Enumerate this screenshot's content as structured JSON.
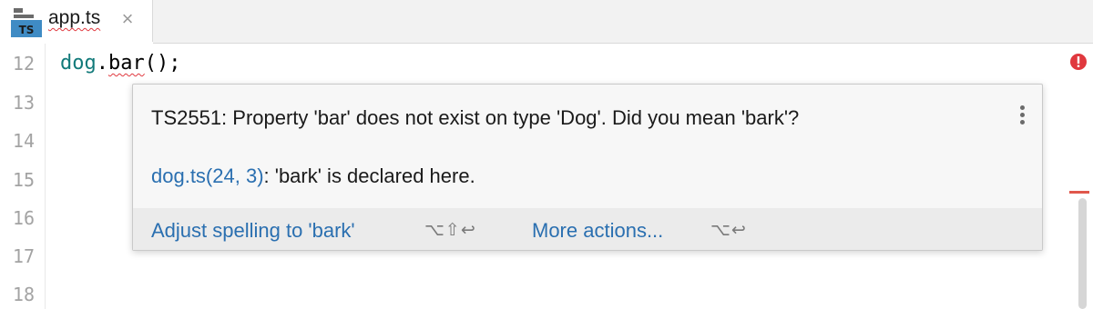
{
  "tab": {
    "icon_label": "TS",
    "file_name": "app.ts",
    "close_glyph": "×"
  },
  "editor": {
    "line_numbers": [
      "12",
      "13",
      "14",
      "15",
      "16",
      "17",
      "18"
    ],
    "code": {
      "ident": "dog",
      "dot": ".",
      "error_token": "bar",
      "rest": "();"
    }
  },
  "popup": {
    "message": "TS2551: Property 'bar' does not exist on type 'Dog'. Did you mean 'bark'?",
    "decl_link": "dog.ts(24, 3)",
    "decl_text": ": 'bark' is declared here.",
    "actions": [
      {
        "label": "Adjust spelling to 'bark'",
        "shortcut": "⌥⇧↩"
      },
      {
        "label": "More actions...",
        "shortcut": "⌥↩"
      }
    ]
  },
  "colors": {
    "accent_link": "#2a6fb0",
    "error": "#e0383e",
    "identifier": "#127a7a",
    "ts_icon_bg": "#3f8bc4"
  },
  "icons": {
    "file_icon": "typescript-file-icon",
    "error_indicator": "error-circle-icon",
    "more": "vertical-ellipsis-icon"
  }
}
